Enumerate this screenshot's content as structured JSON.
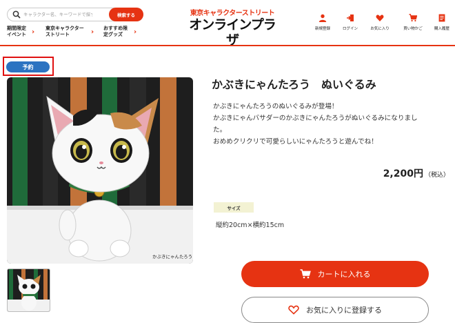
{
  "header": {
    "search": {
      "placeholder": "キャラクター名、キーワードで探す",
      "button_label": "検索する"
    },
    "nav": [
      {
        "label": "期間限定イベント"
      },
      {
        "label": "東京キャラクターストリート"
      },
      {
        "label": "おすすめ限定グッズ"
      }
    ],
    "logo": {
      "line1": "東京キャラクターストリート",
      "line2": "オンラインプラザ"
    },
    "icons": [
      {
        "icon": "user-add-icon",
        "label": "新規登録"
      },
      {
        "icon": "login-icon",
        "label": "ログイン"
      },
      {
        "icon": "heart-icon",
        "label": "お気に入り"
      },
      {
        "icon": "cart-icon",
        "label": "買い物かご"
      },
      {
        "icon": "history-icon",
        "label": "購入履歴"
      }
    ],
    "accent_color": "#e63312"
  },
  "badge": {
    "label": "予約",
    "color": "#2c73c1"
  },
  "product": {
    "title": "かぶきにゃんたろう　ぬいぐるみ",
    "description": [
      "かぶきにゃんたろうのぬいぐるみが登場！",
      "かぶきにゃんバサダーのかぶきにゃんたろうがぬいぐるみになりまし",
      "た。",
      "おめめクリクリで可愛らしいにゃんたろうと遊んでね！"
    ],
    "price": "2,200円",
    "tax_note": "（税込）",
    "size_label": "サイズ",
    "size_value": "縦約20cm×横約15cm",
    "image_caption": "かぶきにゃんたろう"
  },
  "actions": {
    "cart_label": "カートに入れる",
    "favorite_label": "お気に入りに登録する"
  }
}
